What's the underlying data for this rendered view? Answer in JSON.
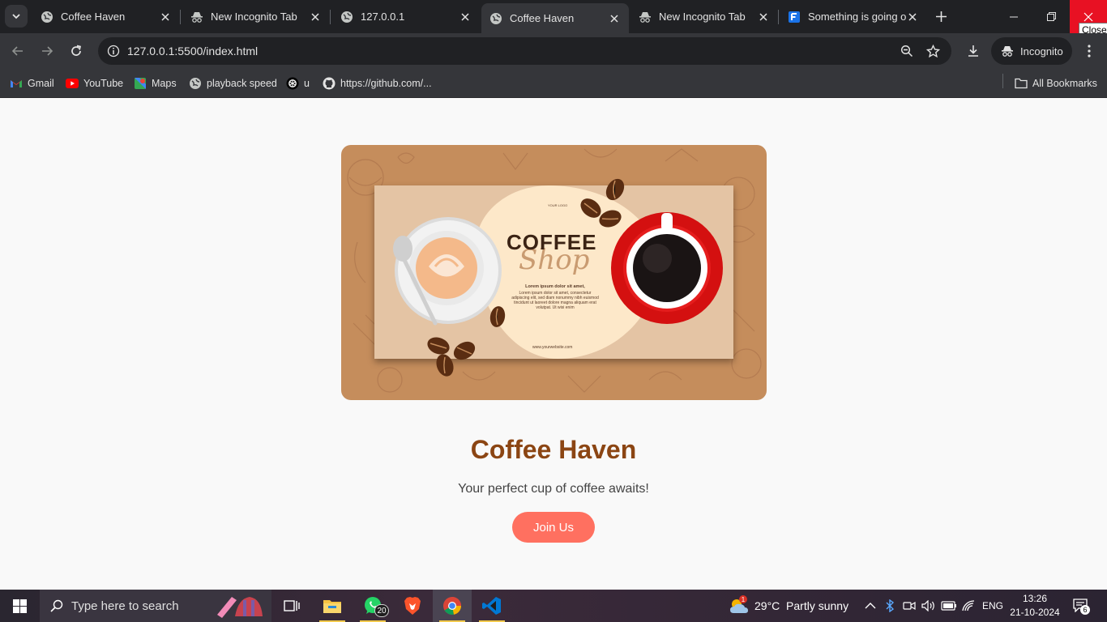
{
  "browser": {
    "tabs": [
      {
        "title": "Coffee Haven",
        "icon": "globe-icon"
      },
      {
        "title": "New Incognito Tab",
        "icon": "incognito-icon"
      },
      {
        "title": "127.0.0.1",
        "icon": "globe-icon"
      },
      {
        "title": "Coffee Haven",
        "icon": "globe-icon",
        "active": true
      },
      {
        "title": "New Incognito Tab",
        "icon": "incognito-icon"
      },
      {
        "title": "Something is going o",
        "icon": "forms-icon"
      }
    ],
    "close_tooltip": "Close",
    "url": "127.0.0.1:5500/index.html",
    "incognito_label": "Incognito",
    "bookmarks": [
      {
        "label": "Gmail",
        "icon": "gmail-icon"
      },
      {
        "label": "YouTube",
        "icon": "youtube-icon"
      },
      {
        "label": "Maps",
        "icon": "maps-icon"
      },
      {
        "label": "playback speed",
        "icon": "globe-icon"
      },
      {
        "label": "u",
        "icon": "chatgpt-icon"
      },
      {
        "label": "https://github.com/...",
        "icon": "github-icon"
      }
    ],
    "all_bookmarks": "All Bookmarks"
  },
  "page": {
    "hero": {
      "title": "COFFEE",
      "script": "Shop",
      "logo": "YOUR LOGO",
      "lorem_heading": "Lorem ipsum dolor sit amet,",
      "lorem_body": "Lorem ipsum dolor sit amet, consectetur adipiscing elit, sed diam nonummy nibh euismod tincidunt ut laoreet dolore magna aliquam erat volutpat. Ut wisi enim",
      "url": "www.yourwebsite.com"
    },
    "heading": "Coffee Haven",
    "subtitle": "Your perfect cup of coffee awaits!",
    "cta": "Join Us"
  },
  "taskbar": {
    "search_placeholder": "Type here to search",
    "whatsapp_badge": "20",
    "weather_badge": "1",
    "weather": "29°C  Partly sunny",
    "language": "ENG",
    "time": "13:26",
    "date": "21-10-2024",
    "notifications": "6"
  },
  "colors": {
    "heading": "#8b4513",
    "cta": "#ff7060",
    "close_button": "#e81123"
  }
}
